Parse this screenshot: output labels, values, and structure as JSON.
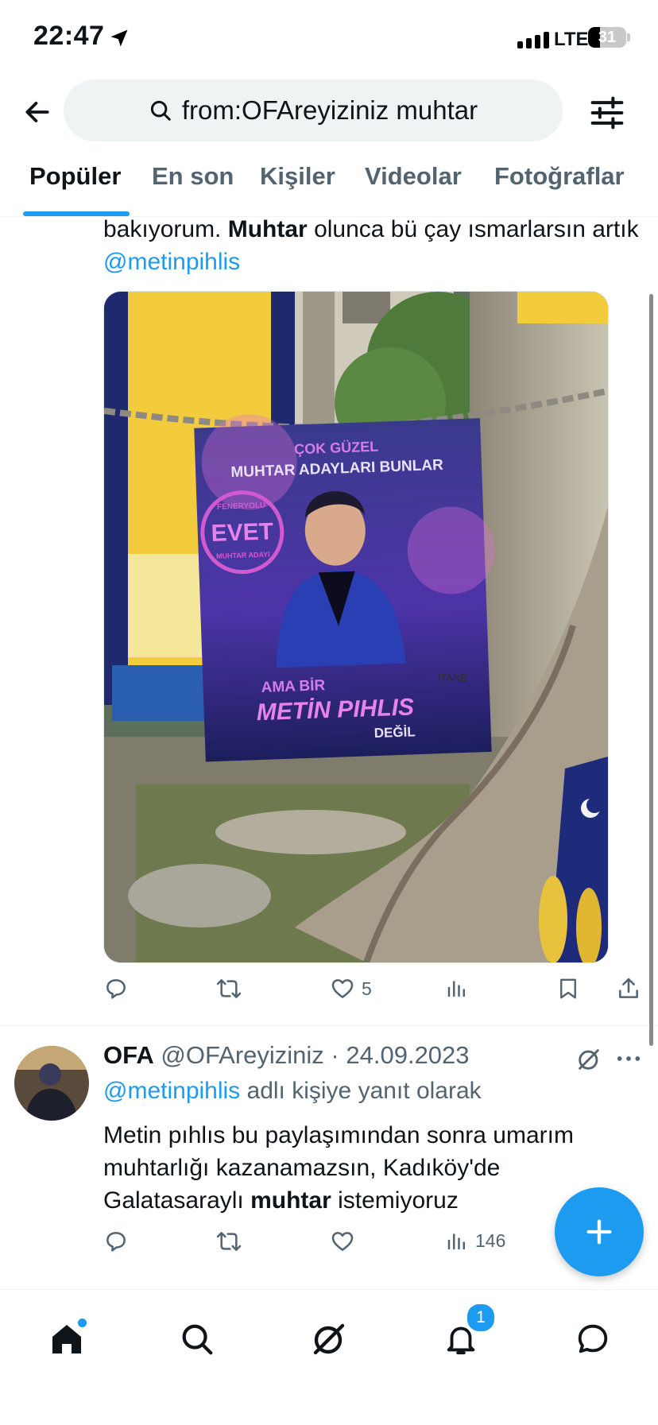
{
  "status_bar": {
    "time": "22:47",
    "network": "LTE",
    "battery": "31"
  },
  "header": {
    "search_query": "from:OFAreyiziniz muhtar"
  },
  "tabs": [
    {
      "label": "Popüler",
      "active": true
    },
    {
      "label": "En son",
      "active": false
    },
    {
      "label": "Kişiler",
      "active": false
    },
    {
      "label": "Videolar",
      "active": false
    },
    {
      "label": "Fotoğraflar",
      "active": false
    }
  ],
  "tweet1": {
    "text_a": "bakıyorum. ",
    "text_bold": "Muhtar",
    "text_b": " olunca bü çay ısmarlarsın artık ",
    "mention": "@metinpihlis",
    "image": {
      "banner_line1": "ÇOK GÜZEL",
      "banner_line2": "MUHTAR ADAYLARI BUNLAR",
      "seal_top": "FENERYOLU",
      "seal_center": "EVET",
      "seal_bottom": "MUHTAR ADAYI",
      "bottom_line1": "AMA BİR",
      "bottom_line2": "METİN PIHLIS",
      "bottom_line3": "DEĞİL",
      "side_text": "ITANE"
    },
    "actions": {
      "like_count": "5"
    }
  },
  "tweet2": {
    "name": "OFA",
    "handle": "@OFAreyiziniz",
    "sep": " · ",
    "date": "24.09.2023",
    "reply_mention": "@metinpihlis",
    "reply_suffix": " adlı kişiye yanıt olarak",
    "text_a": "Metin pıhlıs bu paylaşımından sonra umarım muhtarlığı kazanamazsın, Kadıköy'de Galatasaraylı ",
    "text_bold": "muhtar",
    "text_b": " istemiyoruz",
    "actions": {
      "views_count": "146"
    }
  },
  "nav": {
    "notification_badge": "1"
  },
  "colors": {
    "accent": "#1d9bf0",
    "text": "#0f1419",
    "secondary": "#536471"
  }
}
